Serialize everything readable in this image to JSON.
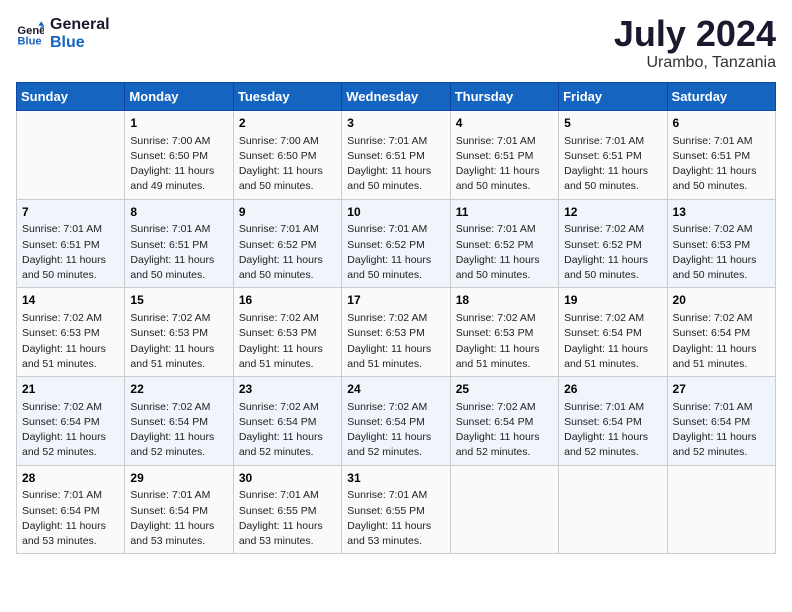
{
  "header": {
    "logo_line1": "General",
    "logo_line2": "Blue",
    "month_title": "July 2024",
    "location": "Urambo, Tanzania"
  },
  "days_of_week": [
    "Sunday",
    "Monday",
    "Tuesday",
    "Wednesday",
    "Thursday",
    "Friday",
    "Saturday"
  ],
  "weeks": [
    [
      {
        "day": "",
        "info": ""
      },
      {
        "day": "1",
        "info": "Sunrise: 7:00 AM\nSunset: 6:50 PM\nDaylight: 11 hours\nand 49 minutes."
      },
      {
        "day": "2",
        "info": "Sunrise: 7:00 AM\nSunset: 6:50 PM\nDaylight: 11 hours\nand 50 minutes."
      },
      {
        "day": "3",
        "info": "Sunrise: 7:01 AM\nSunset: 6:51 PM\nDaylight: 11 hours\nand 50 minutes."
      },
      {
        "day": "4",
        "info": "Sunrise: 7:01 AM\nSunset: 6:51 PM\nDaylight: 11 hours\nand 50 minutes."
      },
      {
        "day": "5",
        "info": "Sunrise: 7:01 AM\nSunset: 6:51 PM\nDaylight: 11 hours\nand 50 minutes."
      },
      {
        "day": "6",
        "info": "Sunrise: 7:01 AM\nSunset: 6:51 PM\nDaylight: 11 hours\nand 50 minutes."
      }
    ],
    [
      {
        "day": "7",
        "info": "Sunrise: 7:01 AM\nSunset: 6:51 PM\nDaylight: 11 hours\nand 50 minutes."
      },
      {
        "day": "8",
        "info": "Sunrise: 7:01 AM\nSunset: 6:51 PM\nDaylight: 11 hours\nand 50 minutes."
      },
      {
        "day": "9",
        "info": "Sunrise: 7:01 AM\nSunset: 6:52 PM\nDaylight: 11 hours\nand 50 minutes."
      },
      {
        "day": "10",
        "info": "Sunrise: 7:01 AM\nSunset: 6:52 PM\nDaylight: 11 hours\nand 50 minutes."
      },
      {
        "day": "11",
        "info": "Sunrise: 7:01 AM\nSunset: 6:52 PM\nDaylight: 11 hours\nand 50 minutes."
      },
      {
        "day": "12",
        "info": "Sunrise: 7:02 AM\nSunset: 6:52 PM\nDaylight: 11 hours\nand 50 minutes."
      },
      {
        "day": "13",
        "info": "Sunrise: 7:02 AM\nSunset: 6:53 PM\nDaylight: 11 hours\nand 50 minutes."
      }
    ],
    [
      {
        "day": "14",
        "info": "Sunrise: 7:02 AM\nSunset: 6:53 PM\nDaylight: 11 hours\nand 51 minutes."
      },
      {
        "day": "15",
        "info": "Sunrise: 7:02 AM\nSunset: 6:53 PM\nDaylight: 11 hours\nand 51 minutes."
      },
      {
        "day": "16",
        "info": "Sunrise: 7:02 AM\nSunset: 6:53 PM\nDaylight: 11 hours\nand 51 minutes."
      },
      {
        "day": "17",
        "info": "Sunrise: 7:02 AM\nSunset: 6:53 PM\nDaylight: 11 hours\nand 51 minutes."
      },
      {
        "day": "18",
        "info": "Sunrise: 7:02 AM\nSunset: 6:53 PM\nDaylight: 11 hours\nand 51 minutes."
      },
      {
        "day": "19",
        "info": "Sunrise: 7:02 AM\nSunset: 6:54 PM\nDaylight: 11 hours\nand 51 minutes."
      },
      {
        "day": "20",
        "info": "Sunrise: 7:02 AM\nSunset: 6:54 PM\nDaylight: 11 hours\nand 51 minutes."
      }
    ],
    [
      {
        "day": "21",
        "info": "Sunrise: 7:02 AM\nSunset: 6:54 PM\nDaylight: 11 hours\nand 52 minutes."
      },
      {
        "day": "22",
        "info": "Sunrise: 7:02 AM\nSunset: 6:54 PM\nDaylight: 11 hours\nand 52 minutes."
      },
      {
        "day": "23",
        "info": "Sunrise: 7:02 AM\nSunset: 6:54 PM\nDaylight: 11 hours\nand 52 minutes."
      },
      {
        "day": "24",
        "info": "Sunrise: 7:02 AM\nSunset: 6:54 PM\nDaylight: 11 hours\nand 52 minutes."
      },
      {
        "day": "25",
        "info": "Sunrise: 7:02 AM\nSunset: 6:54 PM\nDaylight: 11 hours\nand 52 minutes."
      },
      {
        "day": "26",
        "info": "Sunrise: 7:01 AM\nSunset: 6:54 PM\nDaylight: 11 hours\nand 52 minutes."
      },
      {
        "day": "27",
        "info": "Sunrise: 7:01 AM\nSunset: 6:54 PM\nDaylight: 11 hours\nand 52 minutes."
      }
    ],
    [
      {
        "day": "28",
        "info": "Sunrise: 7:01 AM\nSunset: 6:54 PM\nDaylight: 11 hours\nand 53 minutes."
      },
      {
        "day": "29",
        "info": "Sunrise: 7:01 AM\nSunset: 6:54 PM\nDaylight: 11 hours\nand 53 minutes."
      },
      {
        "day": "30",
        "info": "Sunrise: 7:01 AM\nSunset: 6:55 PM\nDaylight: 11 hours\nand 53 minutes."
      },
      {
        "day": "31",
        "info": "Sunrise: 7:01 AM\nSunset: 6:55 PM\nDaylight: 11 hours\nand 53 minutes."
      },
      {
        "day": "",
        "info": ""
      },
      {
        "day": "",
        "info": ""
      },
      {
        "day": "",
        "info": ""
      }
    ]
  ]
}
